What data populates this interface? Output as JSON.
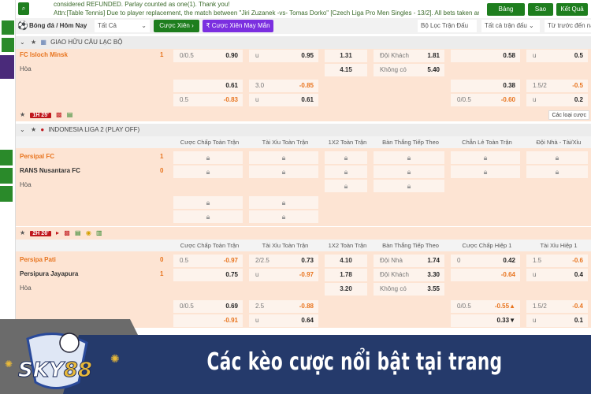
{
  "topbar": {
    "news_line1": "considered REFUNDED. Parlay counted as one(1). Thank you!",
    "news_line2": "Attn:[Table Tennis] Due to player replacement, the match between \"Jiri Zuzanek -vs- Tomas Dorko\" [Czech Liga Pro Men Singles - 13/2]. All bets taken are",
    "buttons": [
      "Bảng Cược",
      "Sao Kê",
      "Kết Quả"
    ]
  },
  "filter": {
    "sport": "Bóng đá / Hôm Nay",
    "category": "Tất Cả",
    "parlay": "Cược Xiên",
    "lucky_parlay": "Cược Xiên May Mắn",
    "match_filter": "Bộ Lọc Trận Đấu",
    "all_matches": "Tất cả trận đấu",
    "sort": "Từ trước đến nay"
  },
  "leagues": [
    {
      "name": "GIAO HỮU CÂU LẠC BỘ"
    },
    {
      "name": "INDONESIA LIGA 2 (PLAY OFF)"
    }
  ],
  "matches": [
    {
      "teams": [
        {
          "name": "FC Isloch Minsk",
          "score": "1",
          "home": true
        },
        {
          "name": "Hòa"
        }
      ],
      "headers": null,
      "rows": [
        [
          [
            "0/0.5",
            "0.90"
          ],
          [
            "u",
            "0.95"
          ],
          [
            "",
            "1.31"
          ],
          [
            "Đội Khách",
            "1.81"
          ],
          [
            "",
            "0.58"
          ],
          [
            "u",
            "0.5"
          ]
        ],
        [
          null,
          null,
          [
            "",
            "4.15"
          ],
          [
            "Không có",
            "5.40"
          ],
          null,
          null
        ],
        [
          [
            "",
            "0.61"
          ],
          [
            "3.0",
            "-0.85"
          ],
          null,
          null,
          [
            "",
            "0.38"
          ],
          [
            "1.5/2",
            "-0.5"
          ]
        ],
        [
          [
            "0.5",
            "-0.83"
          ],
          [
            "u",
            "0.61"
          ],
          null,
          null,
          [
            "0/0.5",
            "-0.60"
          ],
          [
            "u",
            "0.2"
          ]
        ]
      ],
      "footer": {
        "time": "1H 25'",
        "more": "Các loại cược"
      }
    },
    {
      "teams": [
        {
          "name": "Persipal FC",
          "score": "1",
          "home": true
        },
        {
          "name": "RANS Nusantara FC",
          "score": "0"
        },
        {
          "name": "Hòa"
        }
      ],
      "headers": [
        "Cược Chấp Toàn Trận",
        "Tài Xỉu Toàn Trận",
        "1X2 Toàn Trận",
        "Bàn Thắng Tiếp Theo",
        "Chẵn Lẻ Toàn Trận",
        "Đội Nhà - Tài/Xỉu"
      ],
      "rows": [
        [
          "L",
          "L",
          "L",
          "L",
          "L",
          "L"
        ],
        [
          "L",
          "L",
          "L",
          "L",
          "L",
          "L"
        ],
        [
          null,
          null,
          "L",
          "L",
          null,
          null
        ],
        [
          "L",
          "L",
          null,
          null,
          null,
          null
        ],
        [
          "L",
          "L",
          null,
          null,
          null,
          null
        ]
      ],
      "footer": {
        "time": "2H 26'"
      }
    },
    {
      "teams": [
        {
          "name": "Persipa Pati",
          "score": "0",
          "home": true
        },
        {
          "name": "Persipura Jayapura",
          "score": "1"
        },
        {
          "name": "Hòa"
        }
      ],
      "headers": [
        "Cược Chấp Toàn Trận",
        "Tài Xỉu Toàn Trận",
        "1X2 Toàn Trận",
        "Bàn Thắng Tiếp Theo",
        "Cược Chấp Hiệp 1",
        "Tài Xỉu Hiệp 1"
      ],
      "rows": [
        [
          [
            "0.5",
            "-0.97"
          ],
          [
            "2/2.5",
            "0.73"
          ],
          [
            "",
            "4.10"
          ],
          [
            "Đội Nhà",
            "1.74"
          ],
          [
            "0",
            "0.42"
          ],
          [
            "1.5",
            "-0.6"
          ]
        ],
        [
          [
            "",
            "0.75"
          ],
          [
            "u",
            "-0.97"
          ],
          [
            "",
            "1.78"
          ],
          [
            "Đội Khách",
            "3.30"
          ],
          [
            "",
            "-0.64"
          ],
          [
            "u",
            "0.4"
          ]
        ],
        [
          null,
          null,
          [
            "",
            "3.20"
          ],
          [
            "Không có",
            "3.55"
          ],
          null,
          null
        ],
        [
          [
            "0/0.5",
            "0.69"
          ],
          [
            "2.5",
            "-0.88"
          ],
          null,
          null,
          [
            "0/0.5",
            "-0.55▲"
          ],
          [
            "1.5/2",
            "-0.4"
          ]
        ],
        [
          [
            "",
            "-0.91"
          ],
          [
            "u",
            "0.64"
          ],
          null,
          null,
          [
            "",
            "0.33▼"
          ],
          [
            "u",
            "0.1"
          ]
        ]
      ]
    }
  ],
  "banner": {
    "text": "Các kèo cược nổi bật tại trang",
    "logo": "SKY88"
  },
  "colors": {
    "green": "#1e7e1e",
    "purple": "#7b2fe0",
    "peach": "#fde4d3",
    "live": "#c0171c",
    "navy": "#253a6b",
    "negative": "#e8741e"
  }
}
